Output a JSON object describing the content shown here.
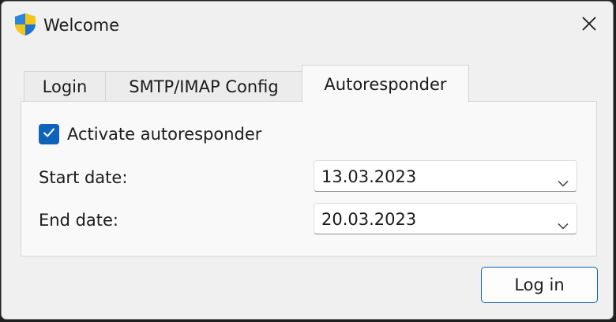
{
  "window": {
    "title": "Welcome",
    "icon": "uac-shield-icon"
  },
  "tabs": [
    {
      "label": "Login",
      "active": false
    },
    {
      "label": "SMTP/IMAP Config",
      "active": false
    },
    {
      "label": "Autoresponder",
      "active": true
    }
  ],
  "autoresponder": {
    "activate_label": "Activate autoresponder",
    "activate_checked": true,
    "start_label": "Start date:",
    "start_value": "13.03.2023",
    "end_label": "End date:",
    "end_value": "20.03.2023"
  },
  "footer": {
    "login_label": "Log in"
  },
  "colors": {
    "accent": "#0f63b8",
    "window_bg": "#f0f0f0",
    "panel_bg": "#f9f9f9"
  }
}
